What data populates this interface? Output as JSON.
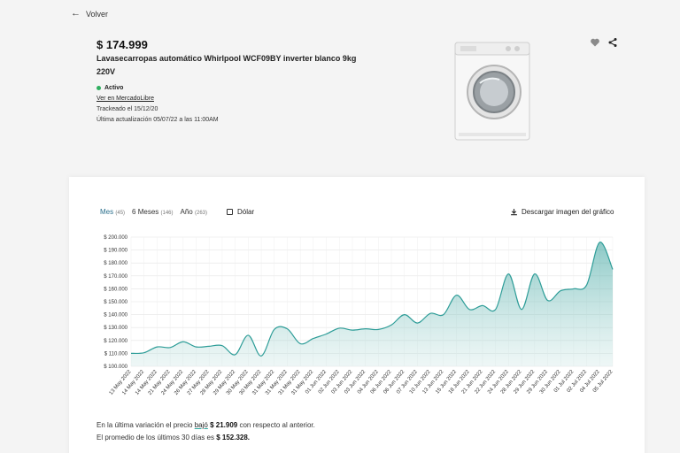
{
  "back": {
    "label": "Volver"
  },
  "product": {
    "price": "$ 174.999",
    "title": "Lavasecarropas automático Whirlpool WCF09BY inverter blanco 9kg 220V",
    "status": "Activo",
    "link": "Ver en MercadoLibre",
    "tracked": "Trackeado el 15/12/20",
    "updated": "Última actualización 05/07/22 a las 11:00AM"
  },
  "colors": {
    "accent": "#2e9d98",
    "fill": "#cfe8e6",
    "active_tab": "#2a6f8c",
    "status": "#2fae5f"
  },
  "icons": {
    "favorite": "heart-icon",
    "share": "share-icon",
    "back": "arrow-left-icon",
    "download": "download-icon"
  },
  "tabs": [
    {
      "label": "Mes",
      "count": "(45)"
    },
    {
      "label": "6 Meses",
      "count": "(146)"
    },
    {
      "label": "Año",
      "count": "(263)"
    }
  ],
  "dolar_label": "Dólar",
  "download_label": "Descargar imagen del gráfico",
  "footer": {
    "line1_pre": "En la última variación el precio",
    "line1_dir": "bajó",
    "line1_amount": "$ 21.909",
    "line1_post": "con respecto al anterior.",
    "line2_pre": "El promedio de los últimos 30 días es",
    "line2_amount": "$ 152.328."
  },
  "chart_data": {
    "type": "area",
    "y_tick_labels": [
      "$ 100.000",
      "$ 110.000",
      "$ 120.000",
      "$ 130.000",
      "$ 140.000",
      "$ 150.000",
      "$ 160.000",
      "$ 170.000",
      "$ 180.000",
      "$ 190.000",
      "$ 200.000"
    ],
    "ylim": [
      100000,
      200000
    ],
    "grid": true,
    "categories": [
      "13 May 2022",
      "14 May 2022",
      "14 May 2022",
      "21 May 2022",
      "24 May 2022",
      "26 May 2022",
      "27 May 2022",
      "28 May 2022",
      "29 May 2022",
      "30 May 2022",
      "30 May 2022",
      "31 May 2022",
      "31 May 2022",
      "31 May 2022",
      "31 May 2022",
      "01 Jun 2022",
      "02 Jun 2022",
      "03 Jun 2022",
      "03 Jun 2022",
      "04 Jun 2022",
      "06 Jun 2022",
      "06 Jun 2022",
      "07 Jun 2022",
      "10 Jun 2022",
      "13 Jun 2022",
      "15 Jun 2022",
      "18 Jun 2022",
      "21 Jun 2022",
      "22 Jun 2022",
      "24 Jun 2022",
      "28 Jun 2022",
      "29 Jun 2022",
      "29 Jun 2022",
      "30 Jun 2022",
      "01 Jul 2022",
      "02 Jul 2022",
      "04 Jul 2022",
      "05 Jul 2022"
    ],
    "values": [
      110000,
      110500,
      115000,
      114500,
      119000,
      115000,
      115500,
      116000,
      109000,
      124000,
      108000,
      128500,
      129000,
      117500,
      121500,
      125000,
      129500,
      128000,
      129000,
      128500,
      132000,
      140000,
      133500,
      141000,
      140000,
      155000,
      144000,
      147000,
      144000,
      171500,
      144000,
      171500,
      151000,
      158500,
      160000,
      163000,
      196000,
      175000
    ]
  }
}
